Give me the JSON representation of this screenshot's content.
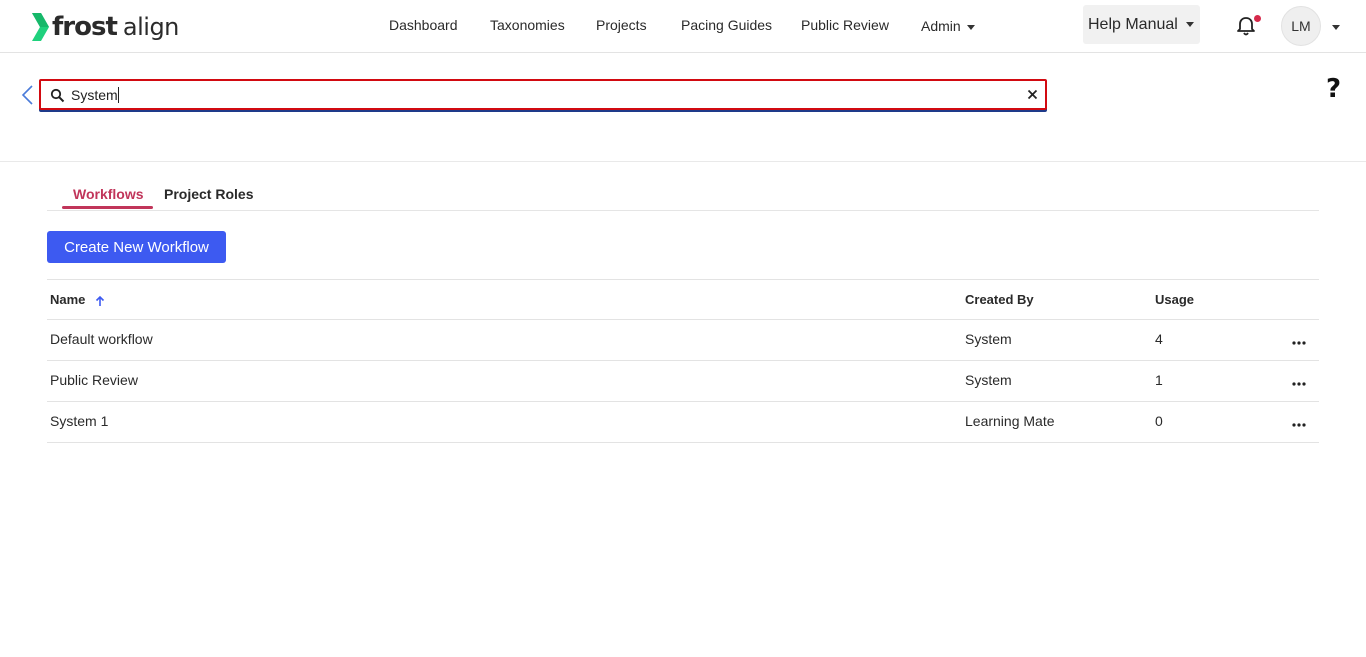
{
  "brand": {
    "name_bold": "frost",
    "name_light": "align",
    "accent": "#1fd17d"
  },
  "nav": {
    "items": [
      "Dashboard",
      "Taxonomies",
      "Projects",
      "Pacing Guides",
      "Public Review",
      "Admin"
    ],
    "help_label": "Help Manual",
    "user_initials": "LM"
  },
  "search": {
    "value": "System",
    "placeholder": ""
  },
  "help_mark": "?",
  "tabs": [
    {
      "label": "Workflows",
      "active": true
    },
    {
      "label": "Project Roles",
      "active": false
    }
  ],
  "create_button": "Create New Workflow",
  "table": {
    "columns": [
      "Name",
      "Created By",
      "Usage"
    ],
    "rows": [
      {
        "name": "Default workflow",
        "created_by": "System",
        "usage": "4"
      },
      {
        "name": "Public Review",
        "created_by": "System",
        "usage": "1"
      },
      {
        "name": "System 1",
        "created_by": "Learning Mate",
        "usage": "0"
      }
    ]
  },
  "colors": {
    "primary_button": "#3d5af1",
    "tab_active": "#c1355a",
    "search_border": "#d20a11",
    "notification_dot": "#d6294b"
  }
}
